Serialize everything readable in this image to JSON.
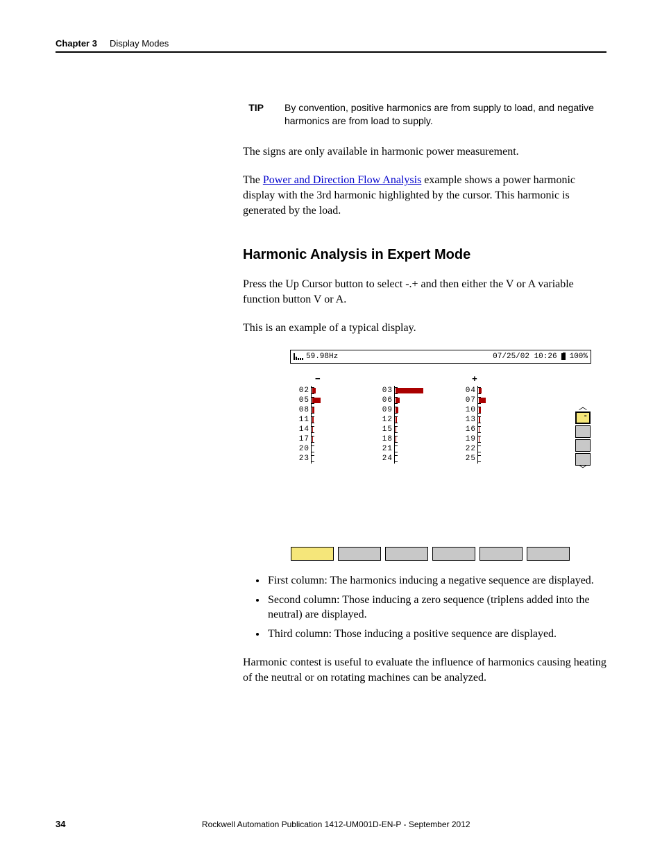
{
  "header": {
    "chapter_label": "Chapter 3",
    "chapter_title": "Display Modes"
  },
  "tip": {
    "label": "TIP",
    "text": "By convention, positive harmonics are from supply to load, and negative harmonics are from load to supply."
  },
  "para1": "The signs are only available in harmonic power measurement.",
  "para2a": "The ",
  "para2_link": "Power and Direction Flow Analysis",
  "para2b": " example shows a power harmonic display with the 3rd harmonic highlighted by the cursor. This harmonic is generated by the load.",
  "section_title": "Harmonic Analysis in Expert Mode",
  "para3": "Press the Up Cursor button to select -.+ and then either the V or A variable function button V or A.",
  "para4": "This is an example of a typical display.",
  "device": {
    "freq": "59.98Hz",
    "date": "07/25/02 10:26",
    "batt": "100%",
    "sign_neg": "−",
    "sign_pos": "+",
    "col1": [
      "02",
      "05",
      "08",
      "11",
      "14",
      "17",
      "20",
      "23"
    ],
    "col2": [
      "03",
      "06",
      "09",
      "12",
      "15",
      "18",
      "21",
      "24"
    ],
    "col3": [
      "04",
      "07",
      "10",
      "13",
      "16",
      "19",
      "22",
      "25"
    ]
  },
  "bullets": [
    "First column: The harmonics inducing a negative sequence are displayed.",
    "Second column: Those inducing a zero sequence (triplens added into the neutral) are displayed.",
    "Third column: Those inducing a positive sequence are displayed."
  ],
  "para5": "Harmonic contest is useful to evaluate the influence of harmonics causing heating of the neutral or on rotating machines can be analyzed.",
  "footer": {
    "page": "34",
    "pub": "Rockwell Automation Publication 1412-UM001D-EN-P - September 2012"
  }
}
